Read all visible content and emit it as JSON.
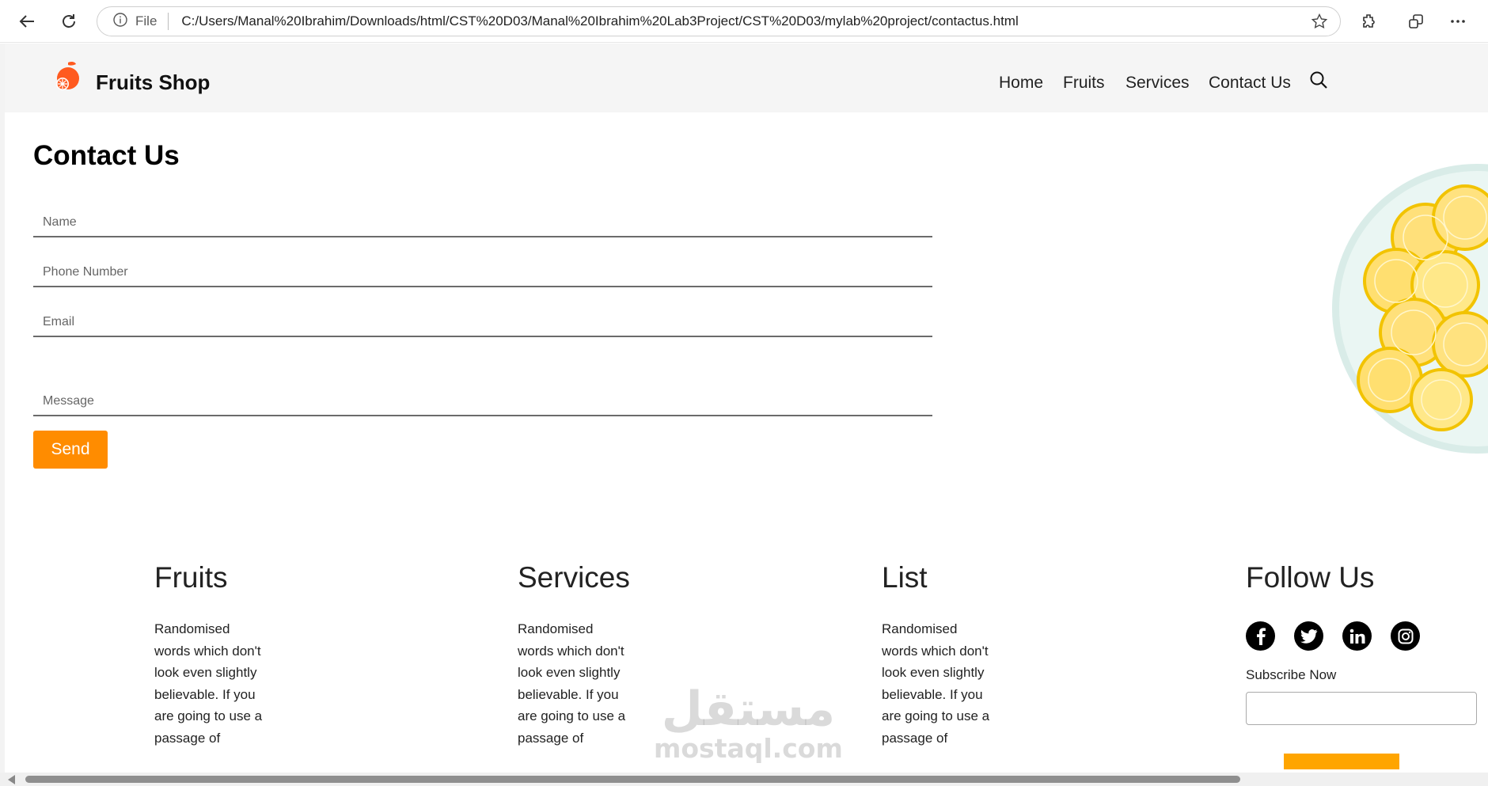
{
  "browser": {
    "file_label": "File",
    "url": "C:/Users/Manal%20Ibrahim/Downloads/html/CST%20D03/Manal%20Ibrahim%20Lab3Project/CST%20D03/mylab%20project/contactus.html",
    "icons": [
      "back-icon",
      "reload-icon",
      "info-icon",
      "star-icon",
      "extensions-icon",
      "collections-icon",
      "more-icon"
    ]
  },
  "header": {
    "brand": "Fruits Shop",
    "nav": [
      "Home",
      "Fruits",
      "Services",
      "Contact Us"
    ],
    "brand_color": "#ff5a1f"
  },
  "contact": {
    "title": "Contact Us",
    "fields": {
      "name_placeholder": "Name",
      "phone_placeholder": "Phone Number",
      "email_placeholder": "Email",
      "message_placeholder": "Message"
    },
    "send_label": "Send",
    "accent": "#ff8c00"
  },
  "footer": {
    "columns": [
      {
        "title": "Fruits",
        "text": "Randomised words which don't look even slightly believable. If you are going to use a passage of"
      },
      {
        "title": "Services",
        "text": "Randomised words which don't look even slightly believable. If you are going to use a passage of"
      },
      {
        "title": "List",
        "text": "Randomised words which don't look even slightly believable. If you are going to use a passage of"
      }
    ],
    "follow": {
      "title": "Follow Us",
      "social_icons": [
        "facebook-icon",
        "twitter-icon",
        "linkedin-icon",
        "instagram-icon"
      ],
      "subscribe_label": "Subscribe Now"
    }
  },
  "watermark": {
    "arabic": "مستقل",
    "latin": "mostaql.com"
  }
}
